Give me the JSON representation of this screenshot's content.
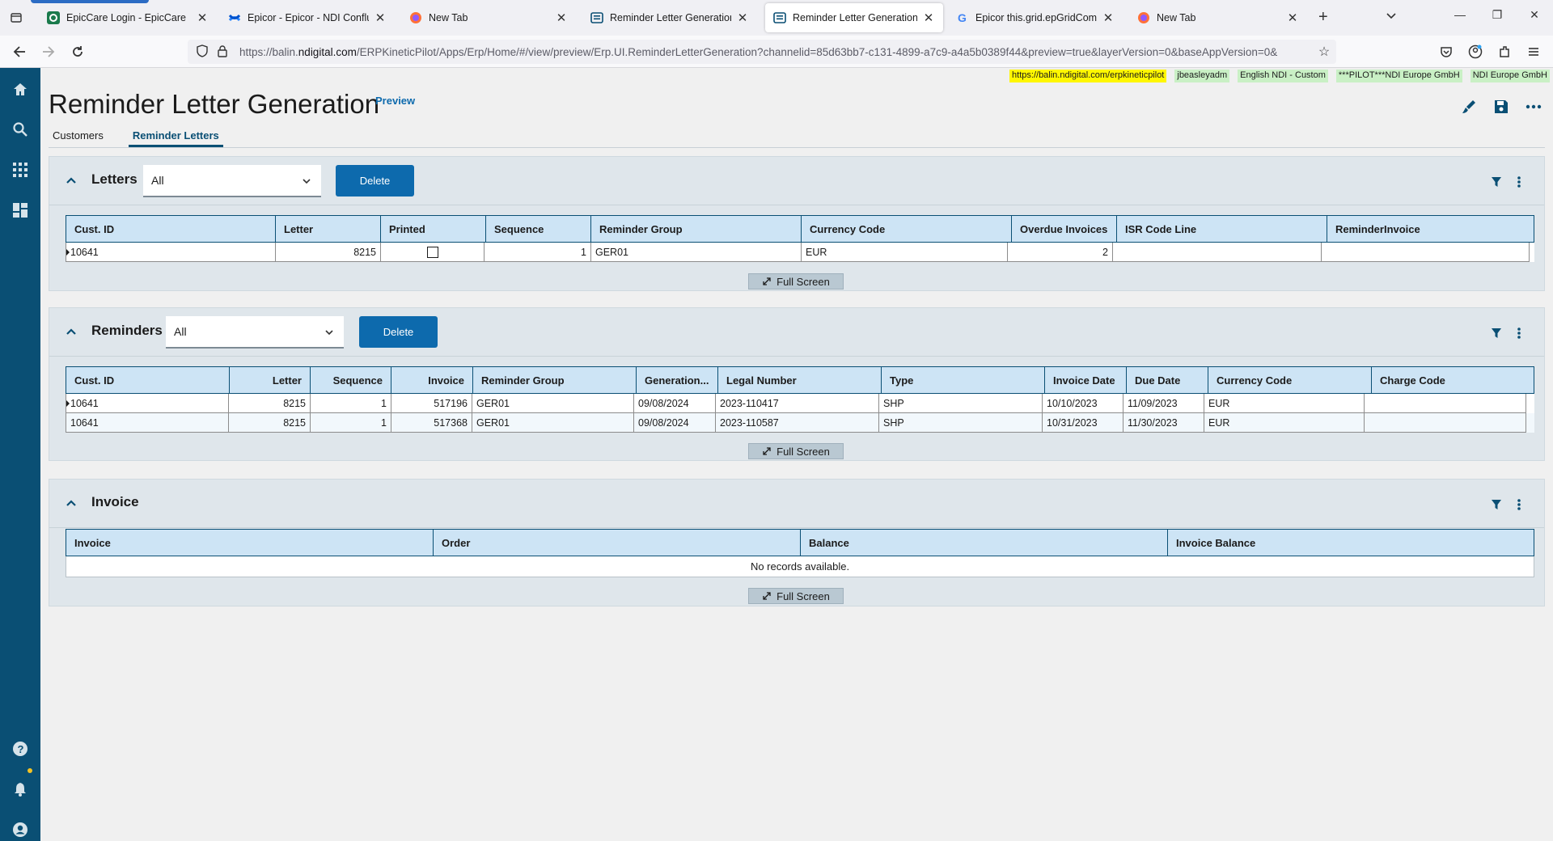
{
  "browser": {
    "tabs": [
      {
        "title": "EpicCare Login - EpicCare",
        "fav": "epiccare"
      },
      {
        "title": "Epicor - Epicor - NDI Confluence",
        "fav": "confluence"
      },
      {
        "title": "New Tab",
        "fav": "firefox"
      },
      {
        "title": "Reminder Letter Generation",
        "fav": "kinetic"
      },
      {
        "title": "Reminder Letter Generation | Preview",
        "fav": "kinetic"
      },
      {
        "title": "Epicor this.grid.epGridComponent",
        "fav": "google"
      },
      {
        "title": "New Tab",
        "fav": "firefox"
      }
    ],
    "active_tab": 4,
    "url_prefix": "https://balin.",
    "url_domain": "ndigital.com",
    "url_rest": "/ERPKineticPilot/Apps/Erp/Home/#/view/preview/Erp.UI.ReminderLetterGeneration?channelid=85d63bb7-c131-4899-a7c9-a4a5b0389f44&preview=true&layerVersion=0&baseAppVersion=0&"
  },
  "status": {
    "url": "https://balin.ndigital.com/erpkineticpilot",
    "user": "jbeasleyadm",
    "language": "English NDI - Custom",
    "company": "***PILOT***NDI Europe GmbH",
    "site": "NDI Europe GmbH"
  },
  "page": {
    "title": "Reminder Letter Generation",
    "preview": "Preview",
    "tabs": [
      "Customers",
      "Reminder Letters"
    ],
    "active_tab": 1
  },
  "letters": {
    "title": "Letters",
    "filter": "All",
    "delete_label": "Delete",
    "fullscreen_label": "Full Screen",
    "columns": [
      "Cust. ID",
      "Letter",
      "Printed",
      "Sequence",
      "Reminder Group",
      "Currency Code",
      "Overdue Invoices",
      "ISR Code Line",
      "ReminderInvoice"
    ],
    "rows": [
      {
        "cust_id": "10641",
        "letter": "8215",
        "printed": false,
        "sequence": "1",
        "reminder_group": "GER01",
        "currency_code": "EUR",
        "overdue_invoices": "2",
        "isr_code_line": "",
        "reminder_invoice": ""
      }
    ]
  },
  "reminders": {
    "title": "Reminders",
    "filter": "All",
    "delete_label": "Delete",
    "fullscreen_label": "Full Screen",
    "columns": [
      "Cust. ID",
      "Letter",
      "Sequence",
      "Invoice",
      "Reminder Group",
      "Generation...",
      "Legal Number",
      "Type",
      "Invoice Date",
      "Due Date",
      "Currency Code",
      "Charge Code"
    ],
    "rows": [
      {
        "cust_id": "10641",
        "letter": "8215",
        "sequence": "1",
        "invoice": "517196",
        "reminder_group": "GER01",
        "generation": "09/08/2024",
        "legal_number": "2023-110417",
        "type": "SHP",
        "invoice_date": "10/10/2023",
        "due_date": "11/09/2023",
        "currency_code": "EUR",
        "charge_code": ""
      },
      {
        "cust_id": "10641",
        "letter": "8215",
        "sequence": "1",
        "invoice": "517368",
        "reminder_group": "GER01",
        "generation": "09/08/2024",
        "legal_number": "2023-110587",
        "type": "SHP",
        "invoice_date": "10/31/2023",
        "due_date": "11/30/2023",
        "currency_code": "EUR",
        "charge_code": ""
      }
    ]
  },
  "invoice": {
    "title": "Invoice",
    "fullscreen_label": "Full Screen",
    "columns": [
      "Invoice",
      "Order",
      "Balance",
      "Invoice Balance"
    ],
    "empty_text": "No records available."
  },
  "colors": {
    "rail": "#0a4f74",
    "accent": "#0d6aad",
    "grid_header": "#cde4f5",
    "panel": "#dfe6eb"
  }
}
